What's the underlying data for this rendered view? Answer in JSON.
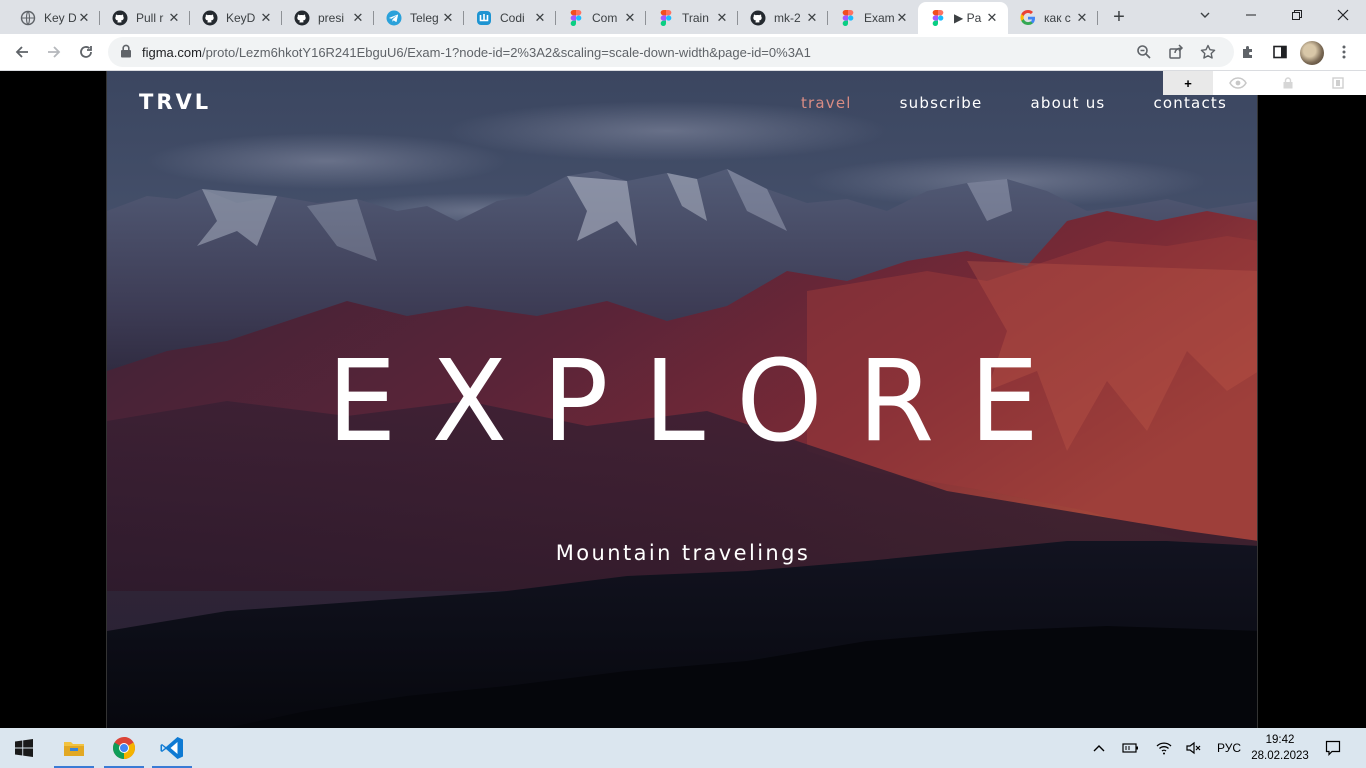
{
  "tabs": [
    {
      "title": "Key D",
      "icon": "globe-icon"
    },
    {
      "title": "Pull r",
      "icon": "github-icon"
    },
    {
      "title": "KeyD",
      "icon": "github-icon"
    },
    {
      "title": "presi",
      "icon": "github-icon"
    },
    {
      "title": "Teleg",
      "icon": "telegram-icon"
    },
    {
      "title": "Codi",
      "icon": "codewars-icon"
    },
    {
      "title": "Com",
      "icon": "figma-icon"
    },
    {
      "title": "Train",
      "icon": "figma-icon"
    },
    {
      "title": "mk-2",
      "icon": "github-icon"
    },
    {
      "title": "Exam",
      "icon": "figma-icon"
    },
    {
      "title": "▶ Pa",
      "icon": "figma-icon",
      "active": true
    },
    {
      "title": "как с",
      "icon": "google-icon"
    }
  ],
  "toolbar": {
    "url_host": "figma.com",
    "url_path": "/proto/Lezm6hkotY16R241EbguU6/Exam-1?node-id=2%3A2&scaling=scale-down-width&page-id=0%3A1"
  },
  "page": {
    "logo": "TRVL",
    "nav": [
      {
        "label": "travel",
        "active": true
      },
      {
        "label": "subscribe"
      },
      {
        "label": "about us"
      },
      {
        "label": "contacts"
      }
    ],
    "hero_title": "EXPLORE",
    "hero_subtitle": "Mountain travelings",
    "accent_color": "#d88c84"
  },
  "figma_controls": {
    "plus": "+"
  },
  "taskbar": {
    "lang": "РУС",
    "time": "19:42",
    "date": "28.02.2023"
  }
}
